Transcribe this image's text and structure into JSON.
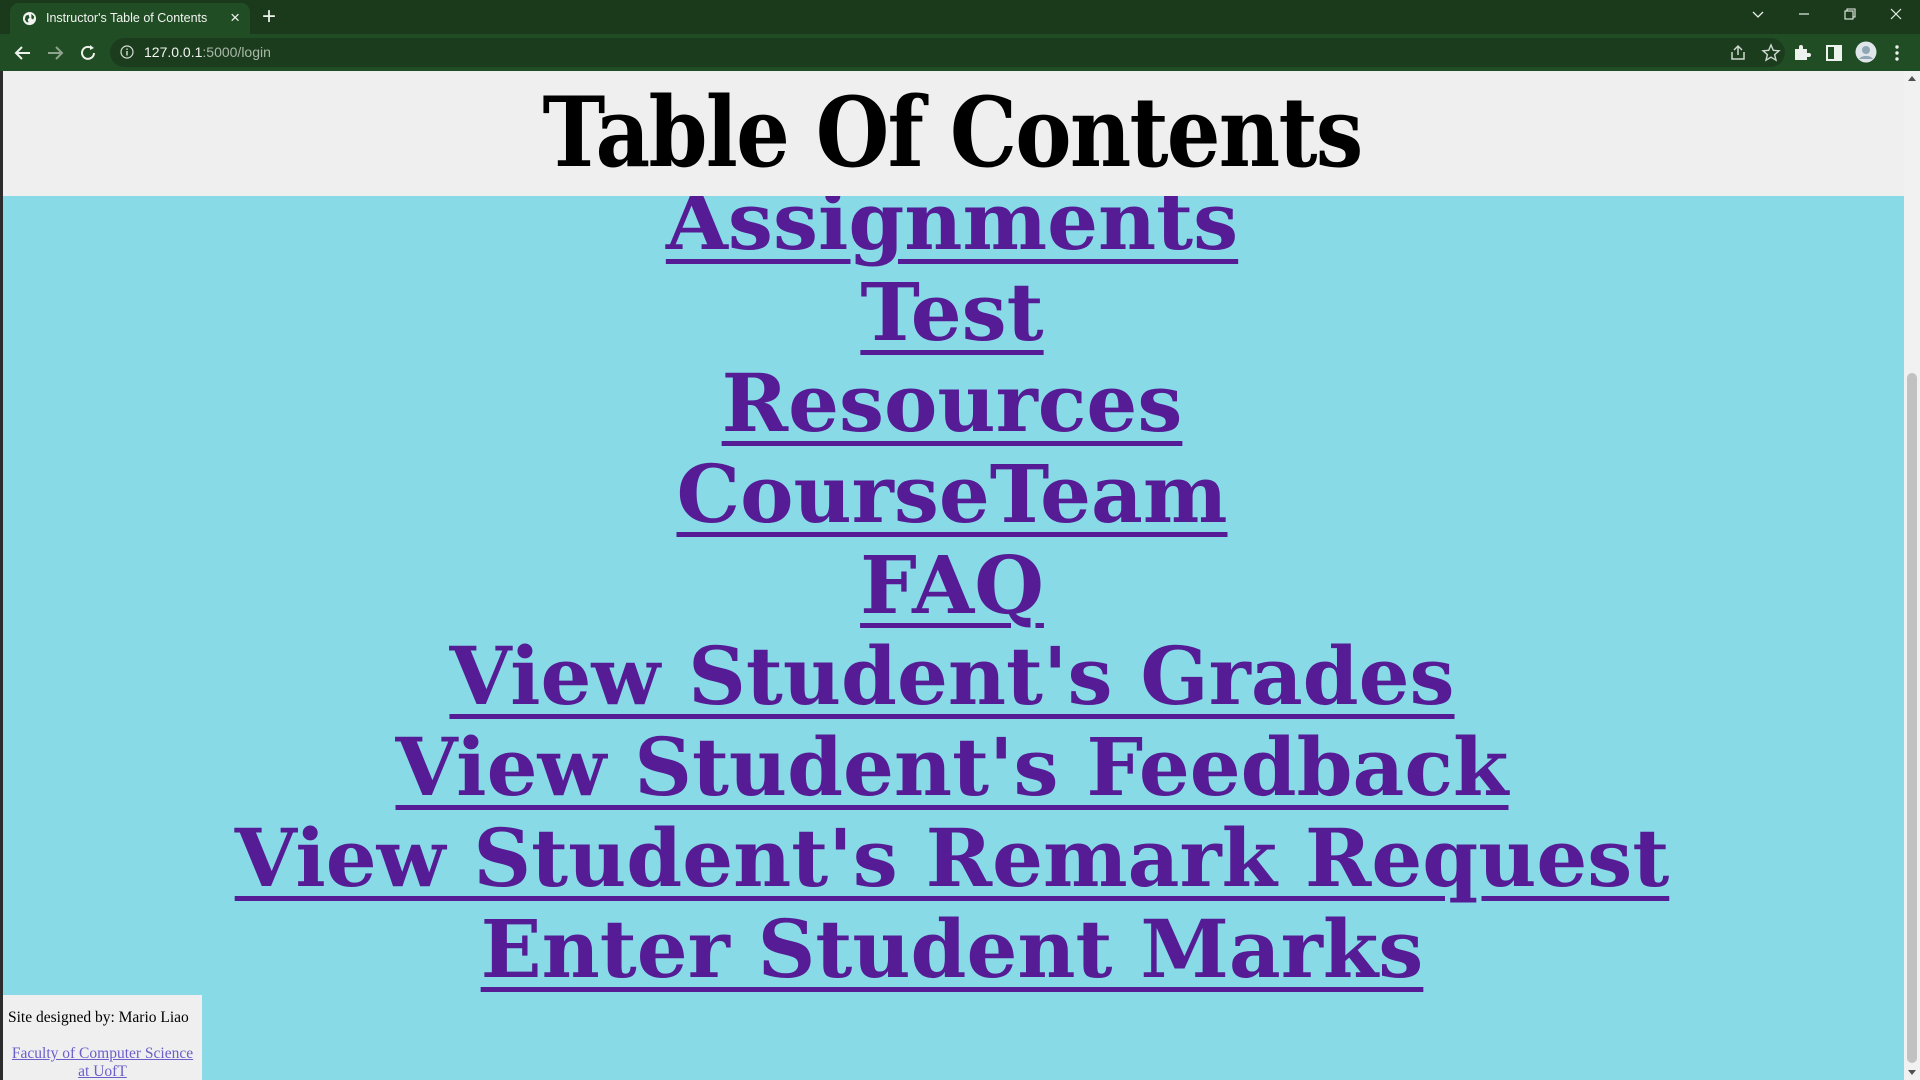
{
  "browser": {
    "tab_title": "Instructor's Table of Contents",
    "url_host": "127.0.0.1",
    "url_rest": ":5000/login",
    "icons": [
      "globe-icon",
      "close-icon",
      "plus-icon",
      "chevron-down-icon",
      "minimize-icon",
      "restore-icon",
      "close-window-icon",
      "back-icon",
      "forward-icon",
      "reload-icon",
      "info-icon",
      "share-icon",
      "star-icon",
      "puzzle-icon",
      "side-panel-icon",
      "profile-avatar",
      "menu-icon"
    ],
    "theme_colors": {
      "tabbar": "#1a3a1b",
      "toolbar": "#214d24"
    }
  },
  "page": {
    "title": "Table Of Contents",
    "links": [
      "Assignments",
      "Test",
      "Resources",
      "CourseTeam",
      "FAQ",
      "View Student's Grades",
      "View Student's Feedback",
      "View Student's Remark Request",
      "Enter Student Marks"
    ],
    "colors": {
      "background": "#87dae6",
      "header": "#f0eff0",
      "link": "#561c95"
    }
  },
  "footer": {
    "credit": "Site designed by: Mario Liao",
    "link_line1": "Faculty of Computer Science",
    "link_line2": "at UofT"
  }
}
